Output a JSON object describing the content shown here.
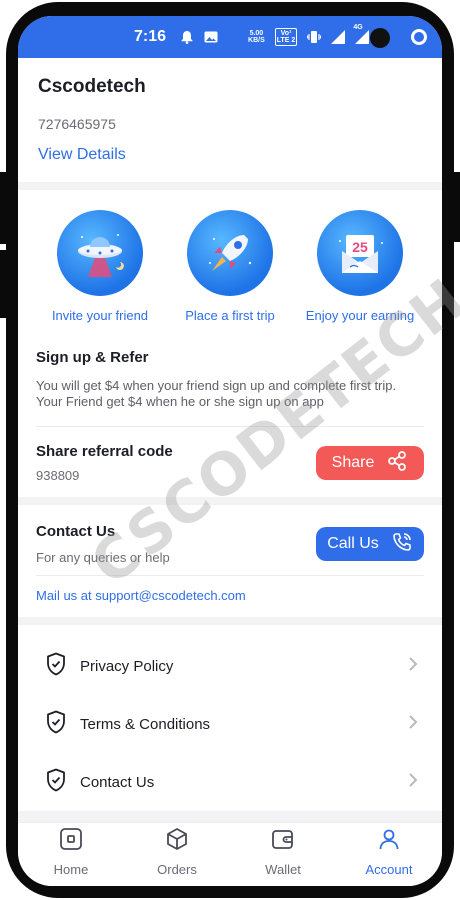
{
  "status_bar": {
    "time": "7:16",
    "net_speed_top": "5.00",
    "net_speed_bottom": "KB/S",
    "lte_top": "Vo¹",
    "lte_bottom": "LTE 2",
    "net_type": "4G",
    "battery_level": "4"
  },
  "profile": {
    "name": "Cscodetech",
    "phone": "7276465975",
    "view_details": "View Details"
  },
  "refer": {
    "steps": [
      {
        "label": "Invite your friend",
        "icon": "ufo-icon"
      },
      {
        "label": "Place a first trip",
        "icon": "rocket-icon"
      },
      {
        "label": "Enjoy your earning",
        "icon": "envelope-25-icon",
        "badge": "25"
      }
    ],
    "title": "Sign up & Refer",
    "description_line1": "You will get $4 when your friend sign up and complete first trip.",
    "description_line2": "Your Friend get $4 when he or she sign up on app",
    "share_label": "Share referral code",
    "share_code": "938809",
    "share_button": "Share"
  },
  "contact": {
    "title": "Contact Us",
    "subtitle": "For any queries or help",
    "call_button": "Call Us",
    "mail_text": "Mail us at support@cscodetech.com"
  },
  "menu": [
    {
      "label": "Privacy Policy",
      "icon": "shield-check-icon"
    },
    {
      "label": "Terms & Conditions",
      "icon": "shield-check-icon"
    },
    {
      "label": "Contact Us",
      "icon": "shield-check-icon"
    }
  ],
  "tabs": [
    {
      "label": "Home",
      "icon": "home-icon",
      "active": false
    },
    {
      "label": "Orders",
      "icon": "box-icon",
      "active": false
    },
    {
      "label": "Wallet",
      "icon": "wallet-icon",
      "active": false
    },
    {
      "label": "Account",
      "icon": "person-icon",
      "active": true
    }
  ],
  "watermark": "CSCODETECH",
  "colors": {
    "primary": "#2f6ee8",
    "share": "#f35a57",
    "text": "#1d1d26",
    "muted": "#6b6b75"
  }
}
